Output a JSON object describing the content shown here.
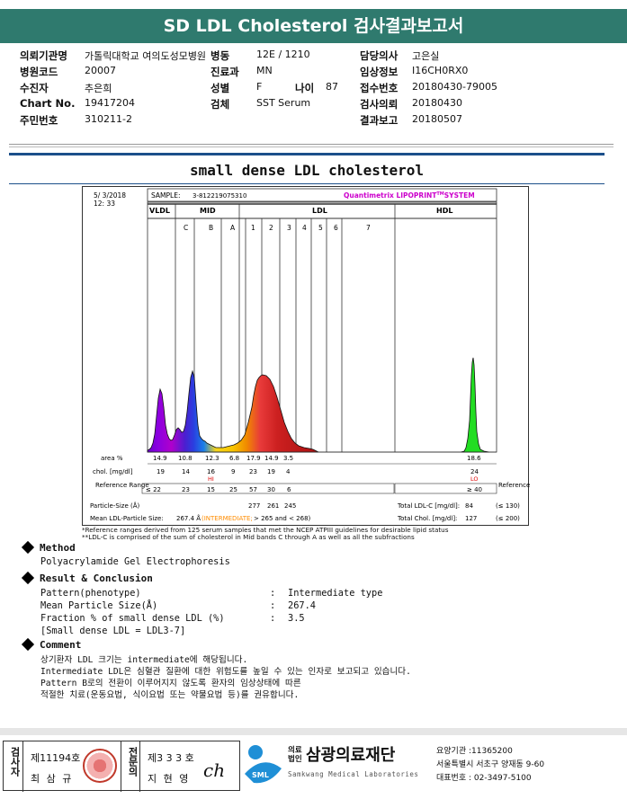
{
  "header": {
    "title": "SD LDL Cholesterol 검사결과보고서"
  },
  "info": {
    "institution_label": "의뢰기관명",
    "institution_value": "가톨릭대학교 여의도성모병원",
    "ward_label": "병동",
    "ward_value": "12E / 1210",
    "doctor_label": "담당의사",
    "doctor_value": "고은실",
    "hospital_code_label": "병원코드",
    "hospital_code_value": "20007",
    "dept_label": "진료과",
    "dept_value": "MN",
    "clinical_label": "임상정보",
    "clinical_value": "I16CH0RX0",
    "patient_label": "수진자",
    "patient_value": "추은희",
    "sex_label": "성별",
    "sex_value": "F",
    "age_label": "나이",
    "age_value": "87",
    "receipt_label": "접수번호",
    "receipt_value": "20180430-79005",
    "chart_label": "Chart No.",
    "chart_value": "19417204",
    "specimen_label": "검체",
    "specimen_value": "SST Serum",
    "request_label": "검사의뢰",
    "request_value": "20180430",
    "id_label": "주민번호",
    "id_value": "310211-2",
    "report_label": "결과보고",
    "report_value": "20180507"
  },
  "report_title": "small dense LDL cholesterol",
  "chart": {
    "date": "5/ 3/2018",
    "time": "12: 33",
    "sample_label": "SAMPLE:",
    "sample_value": "3-812219075310",
    "system_name": "Quantimetrix LIPOPRINT",
    "system_tm": "TM",
    "system_suffix": "SYSTEM",
    "system_color": "#cc00cc",
    "zone_labels": [
      "VLDL",
      "MID",
      "LDL",
      "HDL"
    ],
    "band_labels": [
      "C",
      "B",
      "A",
      "1",
      "2",
      "3",
      "4",
      "5",
      "6",
      "7"
    ],
    "row_area_label": "area %",
    "row_chol_label": "chol. [mg/dl]",
    "row_ref_label": "Reference Range",
    "row_ref_label_right": "Reference Range",
    "area_values": [
      "14.9",
      "10.8",
      "12.3",
      "6.8",
      "17.9",
      "14.9",
      "3.5",
      "18.6"
    ],
    "chol_values": [
      "19",
      "14",
      "16",
      "9",
      "23",
      "19",
      "4",
      "24"
    ],
    "flags": [
      "HI",
      "LO"
    ],
    "ref_values": [
      "≤ 22",
      "23",
      "15",
      "25",
      "57",
      "30",
      "6",
      "≥ 40"
    ],
    "particle_size_label": "Particle-Size (Å)",
    "particle_sizes": [
      "277",
      "261",
      "245"
    ],
    "mean_size_label": "Mean LDL-Particle Size:",
    "mean_size_value": "267.4 Å",
    "mean_size_class": "(INTERMEDIATE;",
    "mean_size_range": "> 265 and < 268)",
    "total_ldl_label": "Total LDL-C [mg/dl]:",
    "total_ldl_value": "84",
    "total_ldl_ref": "(≤ 130)",
    "total_chol_label": "Total Chol. [mg/dl]:",
    "total_chol_value": "127",
    "total_chol_ref": "(≤ 200)",
    "intermediate_color": "#ff8c00",
    "flag_color": "#e00000"
  },
  "footnote": {
    "line1": "*Reference ranges derived from 125 serum samples that met the NCEP ATPIII guidelines for desirable lipid status",
    "line2": "**LDL-C is comprised of the sum of cholesterol in Mid bands C through A as well as all the subfractions"
  },
  "method": {
    "heading": "Method",
    "text": "Polyacrylamide Gel Electrophoresis"
  },
  "result": {
    "heading": "Result & Conclusion",
    "pattern_label": "Pattern(phenotype)",
    "pattern_value": "Intermediate type",
    "size_label": "Mean Particle Size(Å)",
    "size_value": "267.4",
    "fraction_label": "Fraction % of small dense LDL (%)",
    "fraction_value": "3.5",
    "fraction_note": "[Small dense LDL = LDL3-7]",
    "colon": ":"
  },
  "comment": {
    "heading": "Comment",
    "lines": [
      "상기환자 LDL 크기는 intermediate에 해당됩니다.",
      "Intermediate LDL은 심혈관 질환에 대한 위험도를 높일 수 있는 인자로 보고되고 있습니다.",
      "Pattern B로의 전환이 이루어지지 않도록 환자의 임상상태에 따른",
      "적절한 치료(운동요법, 식이요법 또는 약물요법 등)를 권유합니다."
    ]
  },
  "signature": {
    "tester_label": "검사자",
    "tester_no": "제11194호",
    "tester_name": "최 삼 규",
    "pathologist_label": "전문의",
    "pathologist_no": "제3 3 3 호",
    "pathologist_name": "지 현 영",
    "sign_text": "ch"
  },
  "company": {
    "prefix": "의료\n법인",
    "name": "삼광의료재단",
    "english": "Samkwang Medical Laboratories",
    "logo_text": "SML",
    "logo_color": "#1f8fd6",
    "code_line": "요양기관 :11365200",
    "address_line": "서울특별시 서초구 양재동 9-60",
    "phone_line": "대표번호 : 02-3497-5100"
  }
}
